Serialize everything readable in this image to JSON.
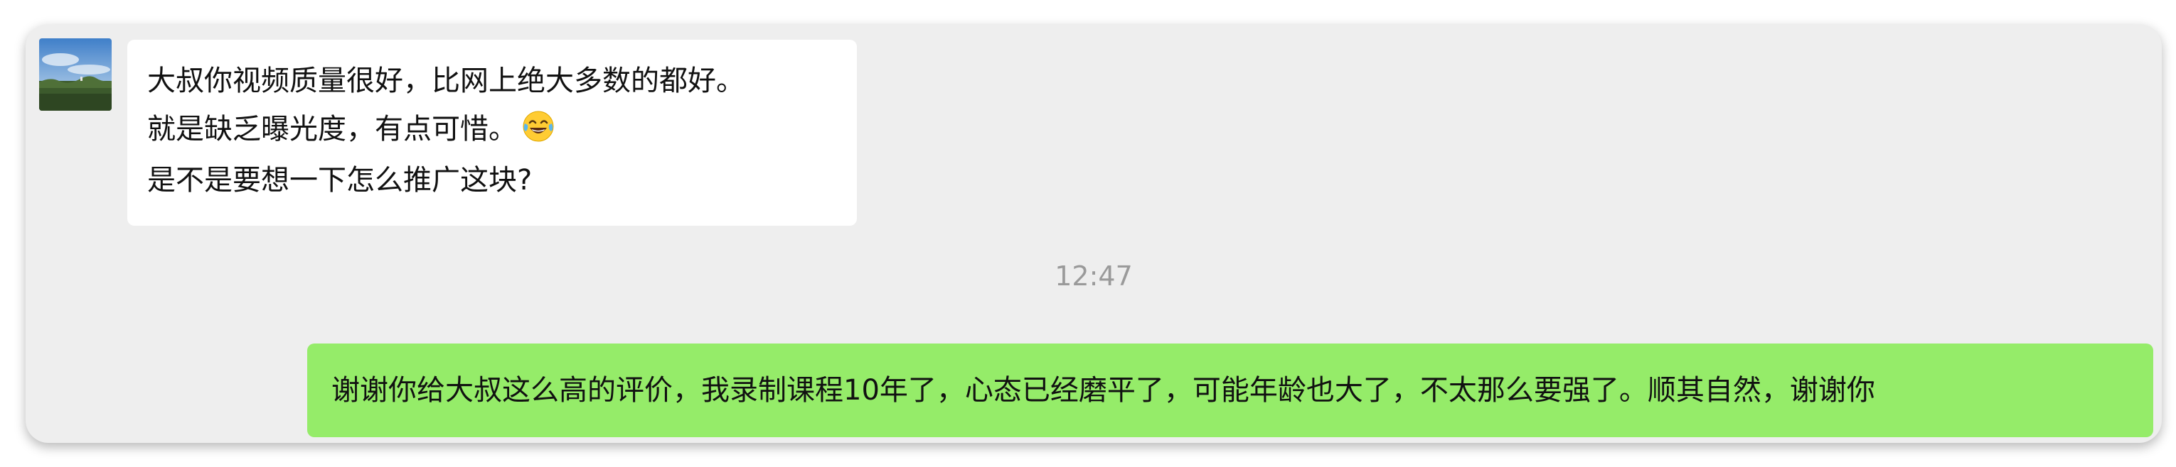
{
  "conversation": {
    "incoming": {
      "line1": "大叔你视频质量很好，比网上绝大多数的都好。",
      "line2": "就是缺乏曝光度，有点可惜。",
      "line2_emoji": "tears-of-joy-emoji",
      "line3": "是不是要想一下怎么推广这块?"
    },
    "timestamp": "12:47",
    "outgoing": {
      "text": "谢谢你给大叔这么高的评价，我录制课程10年了，心态已经磨平了，可能年龄也大了，不太那么要强了。顺其自然，谢谢你"
    }
  },
  "colors": {
    "background": "#eeeeee",
    "incoming_bubble": "#ffffff",
    "outgoing_bubble": "#95ec69",
    "timestamp_text": "#9a9a9a"
  }
}
